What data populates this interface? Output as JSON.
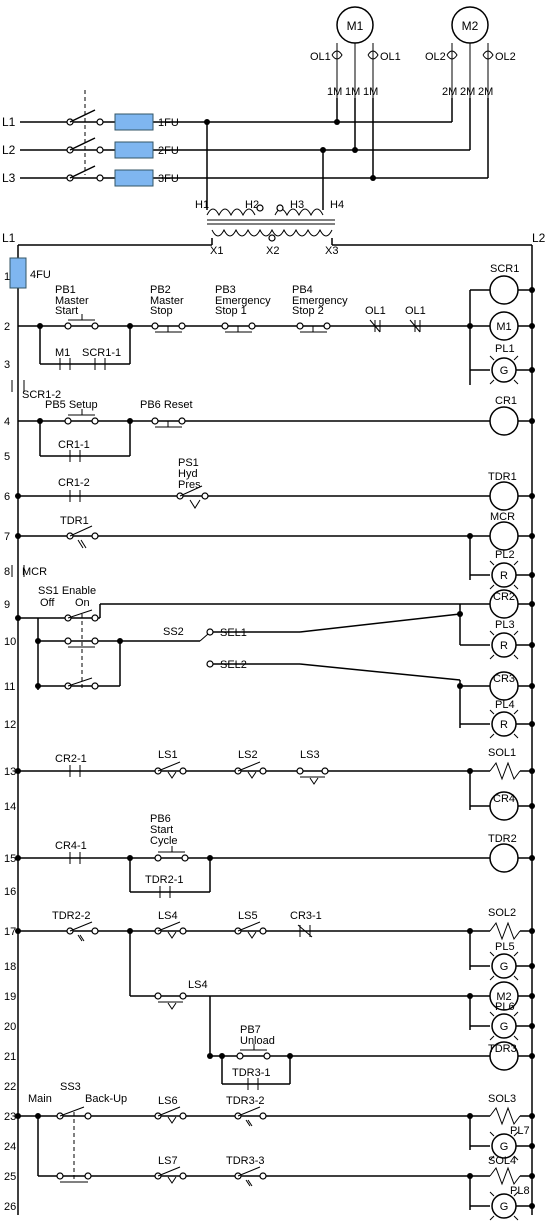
{
  "supply": {
    "l1": "L1",
    "l2": "L2",
    "l3": "L3",
    "fu1": "1FU",
    "fu2": "2FU",
    "fu3": "3FU",
    "fu4": "4FU"
  },
  "motors": {
    "m1": "M1",
    "m2": "M2",
    "ol1": "OL1",
    "ol2": "OL2",
    "tm1": "1M",
    "tm2": "2M"
  },
  "transformer": {
    "h1": "H1",
    "h2": "H2",
    "h3": "H3",
    "h4": "H4",
    "x1": "X1",
    "x2": "X2",
    "x3": "X3"
  },
  "bus": {
    "l1": "L1",
    "l2": "L2"
  },
  "rung_numbers": [
    "1",
    "2",
    "3",
    "4",
    "5",
    "6",
    "7",
    "8",
    "9",
    "10",
    "11",
    "12",
    "13",
    "14",
    "15",
    "16",
    "17",
    "18",
    "19",
    "20",
    "21",
    "22",
    "23",
    "24",
    "25",
    "26"
  ],
  "components": {
    "pb1": {
      "name": "PB1",
      "text": "Master\nStart"
    },
    "pb2": {
      "name": "PB2",
      "text": "Master\nStop"
    },
    "pb3": {
      "name": "PB3",
      "text": "Emergency\nStop 1"
    },
    "pb4": {
      "name": "PB4",
      "text": "Emergency\nStop 2"
    },
    "ol1c": "OL1",
    "ol1c2": "OL1",
    "scr1": "SCR1",
    "m1coil": "M1",
    "pl1": "PL1",
    "m1aux": "M1",
    "scr1_1": "SCR1-1",
    "scr1_2": "SCR1-2",
    "pb5": "PB5 Setup",
    "pb6r": "PB6 Reset",
    "cr1": "CR1",
    "cr1_1": "CR1-1",
    "cr1_2": "CR1-2",
    "ps1": {
      "name": "PS1",
      "text": "Hyd\nPres"
    },
    "tdr1": "TDR1",
    "mcr": "MCR",
    "pl2": "PL2",
    "r": "R",
    "ss1": {
      "name": "SS1 Enable",
      "off": "Off",
      "on": "On"
    },
    "ss2": "SS2",
    "sel1": "SEL1",
    "sel2": "SEL2",
    "cr2": "CR2",
    "cr3": "CR3",
    "pl3": "PL3",
    "pl4": "PL4",
    "cr2_1": "CR2-1",
    "ls1": "LS1",
    "ls2": "LS2",
    "ls3": "LS3",
    "sol1": "SOL1",
    "cr4": "CR4",
    "pb6s": {
      "name": "PB6",
      "text": "Start\nCycle"
    },
    "cr4_1": "CR4-1",
    "tdr2": "TDR2",
    "tdr2_1": "TDR2-1",
    "tdr2_2": "TDR2-2",
    "ls4": "LS4",
    "ls5": "LS5",
    "cr3_1": "CR3-1",
    "sol2": "SOL2",
    "pl5": "PL5",
    "g": "G",
    "m2coil": "M2",
    "pl6": "PL6",
    "pb7": {
      "name": "PB7",
      "text": "Unload"
    },
    "tdr3": "TDR3",
    "tdr3_1": "TDR3-1",
    "ss3": {
      "name": "SS3",
      "main": "Main",
      "backup": "Back-Up"
    },
    "ls6": "LS6",
    "tdr3_2": "TDR3-2",
    "sol3": "SOL3",
    "pl7": "PL7",
    "ls7": "LS7",
    "tdr3_3": "TDR3-3",
    "sol4": "SOL4",
    "pl8": "PL8"
  }
}
